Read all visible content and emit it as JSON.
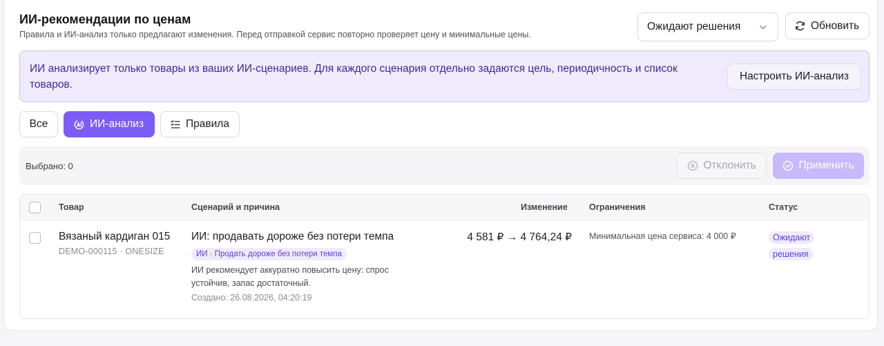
{
  "header": {
    "title": "ИИ-рекомендации по ценам",
    "subtitle": "Правила и ИИ-анализ только предлагают изменения. Перед отправкой сервис повторно проверяет цену и минимальные цены.",
    "status_select": {
      "value": "Ожидают решения",
      "icon": "chevron-down-icon"
    },
    "refresh_label": "Обновить"
  },
  "banner": {
    "text": "ИИ анализирует только товары из ваших ИИ-сценариев. Для каждого сценария отдельно задаются цель, периодичность и список товаров.",
    "configure_label": "Настроить ИИ-анализ"
  },
  "tabs": [
    {
      "label": "Все",
      "active": false
    },
    {
      "label": "ИИ-анализ",
      "active": true,
      "icon": "ai-analysis-icon"
    },
    {
      "label": "Правила",
      "active": false,
      "icon": "rules-list-icon"
    }
  ],
  "selection": {
    "count_text": "Выбрано: 0",
    "reject_label": "Отклонить",
    "apply_label": "Применить"
  },
  "table": {
    "columns": [
      "Товар",
      "Сценарий и причина",
      "Изменение",
      "Ограничения",
      "Статус"
    ],
    "rows": [
      {
        "product_name": "Вязаный кардиган 015",
        "product_sku": "DEMO-000115 · ONESIZE",
        "scenario_title": "ИИ: продавать дороже без потери темпа",
        "scenario_tag": "ИИ · Продать дороже без потери темпа",
        "reason": "ИИ рекомендует аккуратно повысить цену: спрос устойчив, запас достаточный.",
        "created": "Создано: 26.08.2026, 04:20:19",
        "change": "4 581 ₽ → 4 764,24 ₽",
        "limit": "Минимальная цена сервиса: 4 000 ₽",
        "status": "Ожидают решения"
      }
    ]
  },
  "colors": {
    "accent": "#7b5cf5",
    "accent_soft": "#efebfd",
    "accent_text": "#5b3fd6",
    "apply_disabled": "#c7b9fb"
  }
}
